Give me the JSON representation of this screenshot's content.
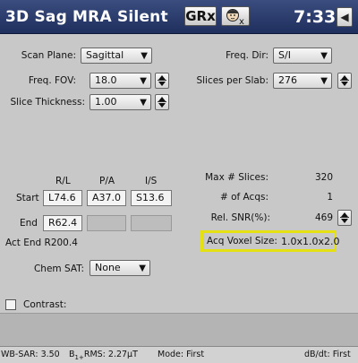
{
  "header": {
    "title": "3D Sag MRA Silent",
    "grx_label": "GRx",
    "patient_badge": "x",
    "clock": "7:33",
    "back_glyph": "◀"
  },
  "scan_plane": {
    "label": "Scan Plane:",
    "value": "Sagittal"
  },
  "freq_fov": {
    "label": "Freq. FOV:",
    "value": "18.0"
  },
  "slice_thickness": {
    "label": "Slice Thickness:",
    "value": "1.00"
  },
  "freq_dir": {
    "label": "Freq. Dir:",
    "value": "S/I"
  },
  "slices_per_slab": {
    "label": "Slices per Slab:",
    "value": "276"
  },
  "location": {
    "col_headers": [
      "R/L",
      "P/A",
      "I/S"
    ],
    "start_label": "Start",
    "start_values": [
      "L74.6",
      "A37.0",
      "S13.6"
    ],
    "end_label": "End",
    "end_value": "R62.4",
    "act_end": "Act End R200.4"
  },
  "stats": {
    "max_slices_label": "Max # Slices:",
    "max_slices_value": "320",
    "acqs_label": "# of Acqs:",
    "acqs_value": "1",
    "snr_label": "Rel. SNR(%):",
    "snr_value": "469",
    "voxel_label": "Acq Voxel Size:",
    "voxel_value": "1.0x1.0x2.0"
  },
  "chem_sat": {
    "label": "Chem SAT:",
    "value": "None"
  },
  "contrast": {
    "label": "Contrast:"
  },
  "statusbar": {
    "wb_sar": "WB-SAR: 3.50",
    "b1_prefix": "B",
    "b1_sub": "1+",
    "b1_rest": "RMS: 2.27μT",
    "mode": "Mode: First",
    "dbdt": "dB/dt: First"
  },
  "colors": {
    "title_bar": "#2c3d6e",
    "panel": "#c8c8c8",
    "highlight_box": "#e5e011"
  },
  "icons": [
    "patient-face-icon",
    "back-arrow-icon",
    "dropdown-arrow-icon",
    "stepper-icon"
  ]
}
